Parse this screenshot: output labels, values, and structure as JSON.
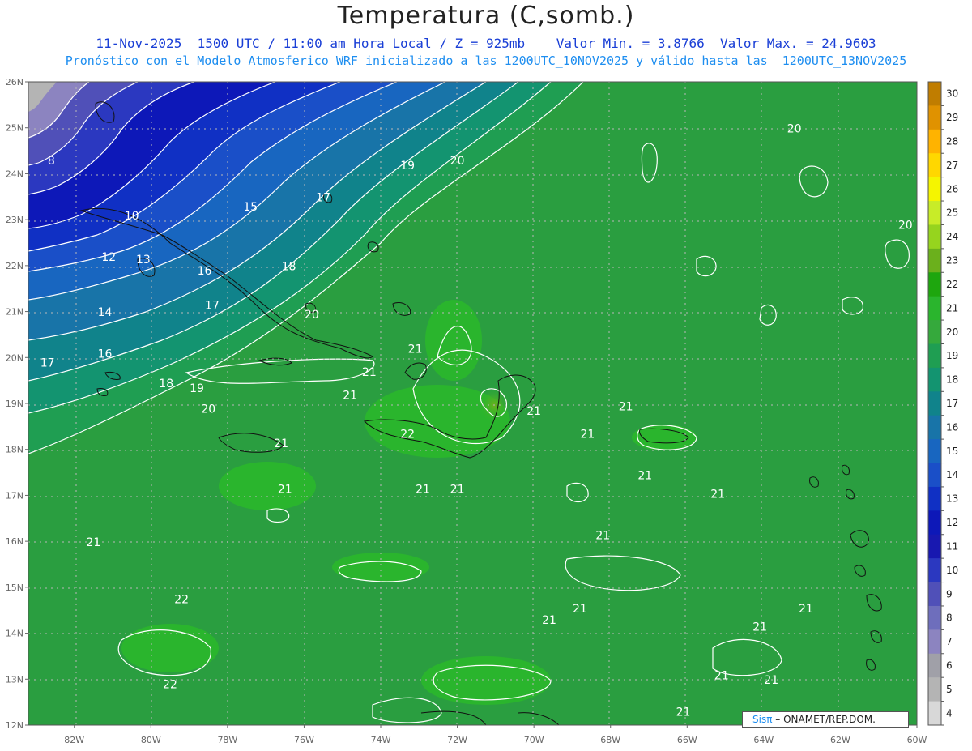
{
  "title": "Temperatura (C,somb.)",
  "subtitle_1": "11-Nov-2025  1500 UTC / 11:00 am Hora Local / Z = 925mb    Valor Min. = 3.8766  Valor Max. = 24.9603",
  "subtitle_2": "Pronóstico con el Modelo Atmosferico WRF inicializado a las 1200UTC_10NOV2025 y válido hasta las  1200UTC_13NOV2025",
  "credit": {
    "logo": "Sisπ",
    "text": "– ONAMET/REP.DOM."
  },
  "map": {
    "lat_ticks": [
      "26N",
      "25N",
      "24N",
      "23N",
      "22N",
      "21N",
      "20N",
      "19N",
      "18N",
      "17N",
      "16N",
      "15N",
      "14N",
      "13N",
      "12N"
    ],
    "lon_ticks": [
      "82W",
      "80W",
      "78W",
      "76W",
      "74W",
      "72W",
      "70W",
      "68W",
      "66W",
      "64W",
      "62W",
      "60W"
    ],
    "lat_range": [
      12,
      26
    ],
    "lon_range": [
      -83.2,
      -60
    ],
    "field_min": 3.8766,
    "field_max": 24.9603,
    "contour_labels": [
      {
        "text": "8",
        "lon": -82.6,
        "lat": 24.2
      },
      {
        "text": "10",
        "lon": -80.5,
        "lat": 23.0
      },
      {
        "text": "12",
        "lon": -81.1,
        "lat": 22.1
      },
      {
        "text": "13",
        "lon": -80.2,
        "lat": 22.05
      },
      {
        "text": "14",
        "lon": -81.2,
        "lat": 20.9
      },
      {
        "text": "15",
        "lon": -77.4,
        "lat": 23.2
      },
      {
        "text": "16",
        "lon": -81.2,
        "lat": 20.0
      },
      {
        "text": "16",
        "lon": -78.6,
        "lat": 21.8
      },
      {
        "text": "17",
        "lon": -82.7,
        "lat": 19.8
      },
      {
        "text": "17",
        "lon": -78.4,
        "lat": 21.05
      },
      {
        "text": "17",
        "lon": -75.5,
        "lat": 23.4
      },
      {
        "text": "18",
        "lon": -79.6,
        "lat": 19.35
      },
      {
        "text": "18",
        "lon": -76.4,
        "lat": 21.9
      },
      {
        "text": "19",
        "lon": -78.8,
        "lat": 19.25
      },
      {
        "text": "19",
        "lon": -73.3,
        "lat": 24.1
      },
      {
        "text": "20",
        "lon": -78.5,
        "lat": 18.8
      },
      {
        "text": "20",
        "lon": -75.8,
        "lat": 20.85
      },
      {
        "text": "20",
        "lon": -72.0,
        "lat": 24.2
      },
      {
        "text": "20",
        "lon": -63.2,
        "lat": 24.9
      },
      {
        "text": "20",
        "lon": -60.3,
        "lat": 22.8
      },
      {
        "text": "21",
        "lon": -73.1,
        "lat": 20.1
      },
      {
        "text": "21",
        "lon": -74.3,
        "lat": 19.6
      },
      {
        "text": "21",
        "lon": -74.8,
        "lat": 19.1
      },
      {
        "text": "21",
        "lon": -70.0,
        "lat": 18.75
      },
      {
        "text": "21",
        "lon": -68.6,
        "lat": 18.25
      },
      {
        "text": "21",
        "lon": -67.6,
        "lat": 18.85
      },
      {
        "text": "21",
        "lon": -76.6,
        "lat": 18.05
      },
      {
        "text": "21",
        "lon": -76.5,
        "lat": 17.05
      },
      {
        "text": "21",
        "lon": -72.9,
        "lat": 17.05
      },
      {
        "text": "21",
        "lon": -72.0,
        "lat": 17.05
      },
      {
        "text": "21",
        "lon": -67.1,
        "lat": 17.35
      },
      {
        "text": "21",
        "lon": -65.2,
        "lat": 16.95
      },
      {
        "text": "21",
        "lon": -81.5,
        "lat": 15.9
      },
      {
        "text": "21",
        "lon": -68.2,
        "lat": 16.05
      },
      {
        "text": "21",
        "lon": -69.6,
        "lat": 14.2
      },
      {
        "text": "21",
        "lon": -68.8,
        "lat": 14.45
      },
      {
        "text": "21",
        "lon": -64.1,
        "lat": 14.05
      },
      {
        "text": "21",
        "lon": -62.9,
        "lat": 14.45
      },
      {
        "text": "21",
        "lon": -65.1,
        "lat": 13.0
      },
      {
        "text": "21",
        "lon": -63.8,
        "lat": 12.9
      },
      {
        "text": "21",
        "lon": -66.1,
        "lat": 12.2
      },
      {
        "text": "22",
        "lon": -73.3,
        "lat": 18.25
      },
      {
        "text": "22",
        "lon": -79.2,
        "lat": 14.65
      },
      {
        "text": "22",
        "lon": -79.5,
        "lat": 12.8
      }
    ]
  },
  "colorbar": {
    "labels": [
      "30",
      "29",
      "28",
      "27",
      "26",
      "25",
      "24",
      "23",
      "22",
      "21",
      "20",
      "19",
      "18",
      "17",
      "16",
      "15",
      "14",
      "13",
      "12",
      "11",
      "10",
      "9",
      "8",
      "7",
      "6",
      "5",
      "4"
    ],
    "colors": [
      "#c07d00",
      "#e09200",
      "#ffb300",
      "#ffd700",
      "#f5f500",
      "#c8ec28",
      "#96d41e",
      "#6bb01c",
      "#1ea60e",
      "#2ab52d",
      "#35a93c",
      "#1f9e52",
      "#139470",
      "#10838b",
      "#1874a8",
      "#1866c0",
      "#1a4fc8",
      "#1030c4",
      "#0d18b8",
      "#1818b0",
      "#2b38c0",
      "#5050b8",
      "#6e6ebc",
      "#8c84c0",
      "#a0a0a8",
      "#b4b4b4",
      "#d8d8d8"
    ]
  }
}
